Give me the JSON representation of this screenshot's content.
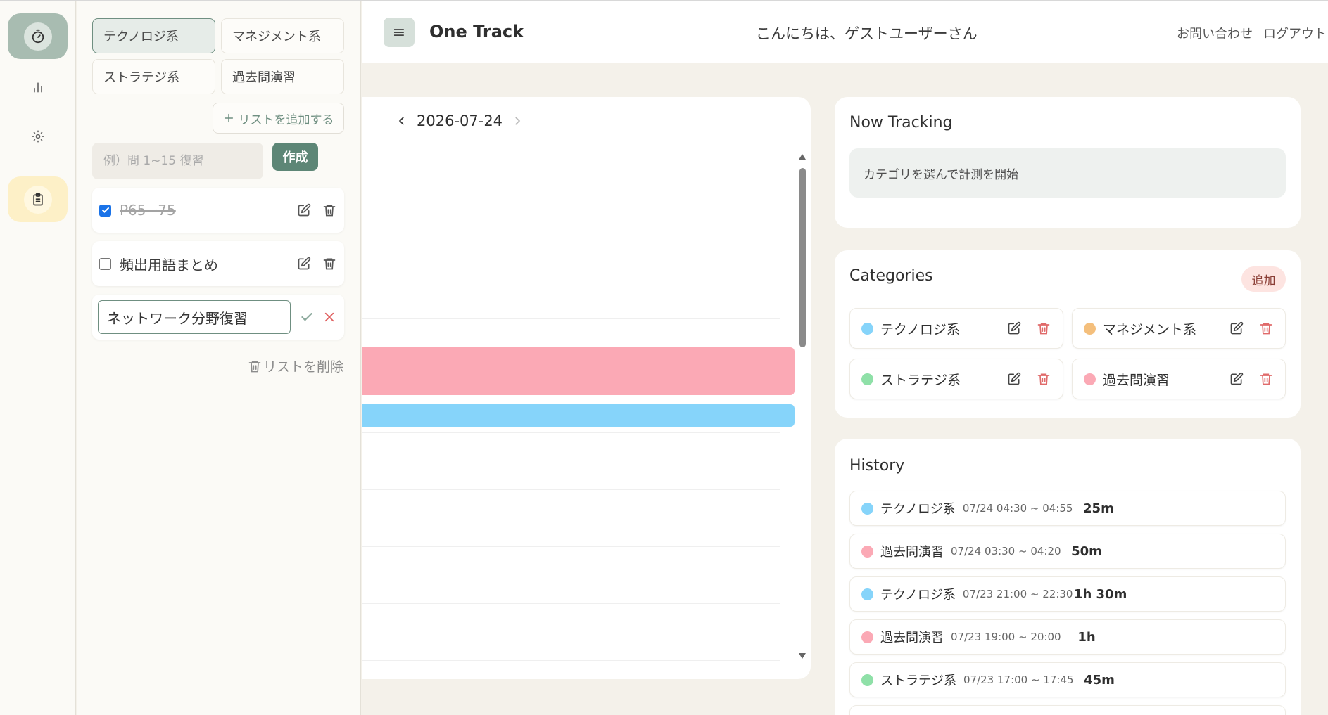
{
  "header": {
    "title": "One Track",
    "menu_icon": "≡",
    "greeting": "こんにちは、ゲストユーザーさん",
    "contact": "お問い合わせ",
    "logout": "ログアウト"
  },
  "rail": {
    "items": [
      "timer-icon",
      "chart-icon",
      "gear-icon",
      "clipboard-icon"
    ]
  },
  "todo_panel": {
    "tabs": [
      {
        "label": "テクノロジ系",
        "active": true
      },
      {
        "label": "マネジメント系",
        "active": false
      },
      {
        "label": "ストラテジ系",
        "active": false
      },
      {
        "label": "過去問演習",
        "active": false
      }
    ],
    "add_list": "リストを追加する",
    "new_placeholder": "例）問 1~15 復習",
    "create": "作成",
    "items": [
      {
        "text": "P65~75",
        "done": true
      },
      {
        "text": "頻出用語まとめ",
        "done": false
      }
    ],
    "editing_value": "ネットワーク分野復習",
    "delete_list": "リストを削除"
  },
  "timeline": {
    "date": "2026-07-24",
    "bars": [
      {
        "color": "#fba9b5"
      },
      {
        "color": "#86d4fa"
      }
    ]
  },
  "now_tracking": {
    "title": "Now Tracking",
    "message": "カテゴリを選んで計測を開始"
  },
  "categories": {
    "title": "Categories",
    "add": "追加",
    "items": [
      {
        "name": "テクノロジ系",
        "color": "#86d4fa"
      },
      {
        "name": "マネジメント系",
        "color": "#f4bf7c"
      },
      {
        "name": "ストラテジ系",
        "color": "#8fe0a8"
      },
      {
        "name": "過去問演習",
        "color": "#fba9b5"
      }
    ]
  },
  "history": {
    "title": "History",
    "items": [
      {
        "name": "テクノロジ系",
        "time": "07/24 04:30 ~ 04:55",
        "duration": "25m",
        "color": "#86d4fa"
      },
      {
        "name": "過去問演習",
        "time": "07/24 03:30 ~ 04:20",
        "duration": "50m",
        "color": "#fba9b5"
      },
      {
        "name": "テクノロジ系",
        "time": "07/23 21:00 ~ 22:30",
        "duration": "1h 30m",
        "color": "#86d4fa"
      },
      {
        "name": "過去問演習",
        "time": "07/23 19:00 ~ 20:00",
        "duration": "1h",
        "color": "#fba9b5"
      },
      {
        "name": "ストラテジ系",
        "time": "07/23 17:00 ~ 17:45",
        "duration": "45m",
        "color": "#8fe0a8"
      }
    ]
  }
}
